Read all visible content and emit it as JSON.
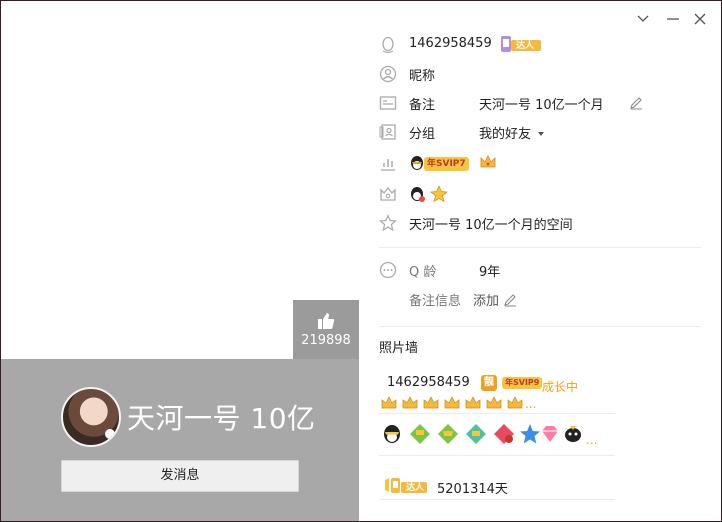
{
  "window": {
    "controls": [
      "dropdown-icon",
      "minimize-icon",
      "close-icon"
    ]
  },
  "left": {
    "like_count": "219898",
    "display_name": "天河一号 10亿",
    "send_button_label": "发消息"
  },
  "info": {
    "qq_number": "1462958459",
    "talent_badge": "达人",
    "nickname_label": "昵称",
    "remark_label": "备注",
    "remark_value": "天河一号 10亿一个月",
    "group_label": "分组",
    "group_value": "我的好友",
    "svip_badge": "年SVIP7",
    "space_link": "天河一号 10亿一个月的空间",
    "qage_label": "Q 龄",
    "qage_value": "9年",
    "remark_info_label": "备注信息",
    "add_label": "添加"
  },
  "photo_wall": {
    "title": "照片墙",
    "qq_number": "1462958459",
    "liang_badge": "靓",
    "svip_badge": "年SVIP9",
    "growing": "成长中",
    "more": "...",
    "talent_badge": "达人",
    "days": "5201314天"
  },
  "colors": {
    "gold": "#f0a020",
    "card_gray": "#a8a8a8",
    "like_gray": "#9b9b9b"
  }
}
